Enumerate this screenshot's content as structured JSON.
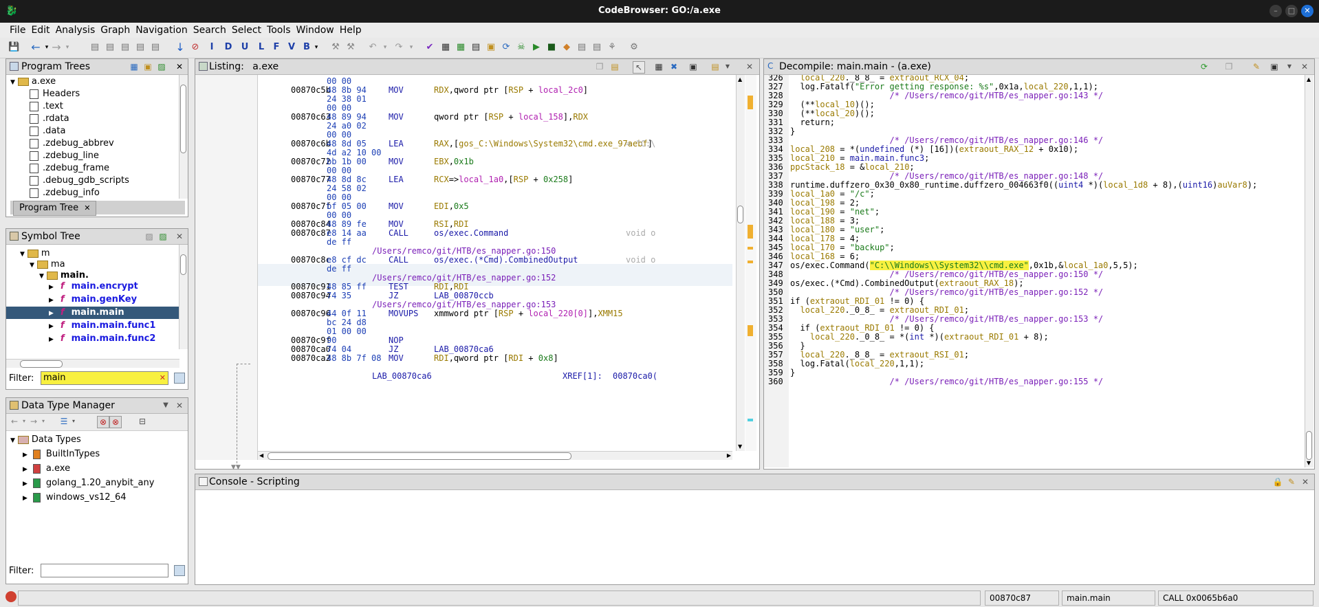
{
  "window": {
    "title": "CodeBrowser: GO:/a.exe"
  },
  "menu": [
    "File",
    "Edit",
    "Analysis",
    "Graph",
    "Navigation",
    "Search",
    "Select",
    "Tools",
    "Window",
    "Help"
  ],
  "program_trees": {
    "title": "Program Trees",
    "root": "a.exe",
    "items": [
      "Headers",
      ".text",
      ".rdata",
      ".data",
      ".zdebug_abbrev",
      ".zdebug_line",
      ".zdebug_frame",
      ".debug_gdb_scripts",
      ".zdebug_info"
    ],
    "tab_label": "Program Tree"
  },
  "symbol_tree": {
    "title": "Symbol Tree",
    "folders": [
      "m",
      "ma",
      "main."
    ],
    "functions": [
      "main.encrypt",
      "main.genKey",
      "main.main",
      "main.main.func1",
      "main.main.func2"
    ],
    "filter_label": "Filter:",
    "filter_value": "main"
  },
  "data_type_manager": {
    "title": "Data Type Manager",
    "root": "Data Types",
    "items": [
      "BuiltInTypes",
      "a.exe",
      "golang_1.20_anybit_any",
      "windows_vs12_64"
    ],
    "filter_label": "Filter:"
  },
  "listing": {
    "title": "Listing:",
    "program": "a.exe",
    "rows": [
      {
        "addr": "",
        "bytes": "00 00",
        "mnem": "",
        "ops": ""
      },
      {
        "addr": "00870c5b",
        "bytes": "48 8b 94",
        "mnem": "MOV",
        "ops": "RDX,qword ptr [RSP + local_2c0]"
      },
      {
        "addr": "",
        "bytes": "24 38 01",
        "mnem": "",
        "ops": ""
      },
      {
        "addr": "",
        "bytes": "00 00",
        "mnem": "",
        "ops": ""
      },
      {
        "addr": "00870c63",
        "bytes": "48 89 94",
        "mnem": "MOV",
        "ops": "qword ptr [RSP + local_158],RDX"
      },
      {
        "addr": "",
        "bytes": "24 a0 02",
        "mnem": "",
        "ops": ""
      },
      {
        "addr": "",
        "bytes": "00 00",
        "mnem": "",
        "ops": ""
      },
      {
        "addr": "00870c6b",
        "bytes": "48 8d 05",
        "mnem": "LEA",
        "ops": "RAX,[gos_C:\\Windows\\System32\\cmd.exe_97aebf]",
        "right": "= \"C:\\"
      },
      {
        "addr": "",
        "bytes": "4d a2 10 00",
        "mnem": "",
        "ops": ""
      },
      {
        "addr": "00870c72",
        "bytes": "bb 1b 00",
        "mnem": "MOV",
        "ops": "EBX,0x1b"
      },
      {
        "addr": "",
        "bytes": "00 00",
        "mnem": "",
        "ops": ""
      },
      {
        "addr": "00870c77",
        "bytes": "48 8d 8c",
        "mnem": "LEA",
        "ops": "RCX=>local_1a0,[RSP + 0x258]"
      },
      {
        "addr": "",
        "bytes": "24 58 02",
        "mnem": "",
        "ops": ""
      },
      {
        "addr": "",
        "bytes": "00 00",
        "mnem": "",
        "ops": ""
      },
      {
        "addr": "00870c7f",
        "bytes": "bf 05 00",
        "mnem": "MOV",
        "ops": "EDI,0x5"
      },
      {
        "addr": "",
        "bytes": "00 00",
        "mnem": "",
        "ops": ""
      },
      {
        "addr": "00870c84",
        "bytes": "48 89 fe",
        "mnem": "MOV",
        "ops": "RSI,RDI"
      },
      {
        "addr": "00870c87",
        "bytes": "e8 14 aa",
        "mnem": "CALL",
        "ops": "os/exec.Command",
        "right": "void o"
      },
      {
        "addr": "",
        "bytes": "de ff",
        "mnem": "",
        "ops": ""
      },
      {
        "addr": "",
        "bytes": "",
        "mnem": "",
        "ops": "",
        "path": "/Users/remco/git/HTB/es_napper.go:150"
      },
      {
        "addr": "00870c8c",
        "bytes": "e8 cf dc",
        "mnem": "CALL",
        "ops": "os/exec.(*Cmd).CombinedOutput",
        "right": "void o"
      },
      {
        "addr": "",
        "bytes": "de ff",
        "mnem": "",
        "ops": ""
      },
      {
        "addr": "",
        "bytes": "",
        "mnem": "",
        "ops": "",
        "path": "/Users/remco/git/HTB/es_napper.go:152"
      },
      {
        "addr": "00870c91",
        "bytes": "48 85 ff",
        "mnem": "TEST",
        "ops": "RDI,RDI"
      },
      {
        "addr": "00870c94",
        "bytes": "74 35",
        "mnem": "JZ",
        "ops": "LAB_00870ccb"
      },
      {
        "addr": "",
        "bytes": "",
        "mnem": "",
        "ops": "",
        "path": "/Users/remco/git/HTB/es_napper.go:153"
      },
      {
        "addr": "00870c96",
        "bytes": "44 0f 11",
        "mnem": "MOVUPS",
        "ops": "xmmword ptr [RSP + local_220[0]],XMM15"
      },
      {
        "addr": "",
        "bytes": "bc 24 d8",
        "mnem": "",
        "ops": ""
      },
      {
        "addr": "",
        "bytes": "01 00 00",
        "mnem": "",
        "ops": ""
      },
      {
        "addr": "00870c9f",
        "bytes": "90",
        "mnem": "NOP",
        "ops": ""
      },
      {
        "addr": "00870ca0",
        "bytes": "74 04",
        "mnem": "JZ",
        "ops": "LAB_00870ca6"
      },
      {
        "addr": "00870ca2",
        "bytes": "48 8b 7f 08",
        "mnem": "MOV",
        "ops": "RDI,qword ptr [RDI + 0x8]"
      },
      {
        "addr": "",
        "bytes": "",
        "mnem": "",
        "ops": ""
      },
      {
        "addr": "",
        "bytes": "",
        "mnem": "",
        "ops": "",
        "label": "LAB_00870ca6",
        "xref": "XREF[1]:",
        "xref_to": "00870ca0("
      }
    ]
  },
  "decompile": {
    "title": "Decompile: main.main -  (a.exe)",
    "lines": [
      {
        "n": "326",
        "t": "  local_220._8_8_ = extraout_RCX_04;"
      },
      {
        "n": "327",
        "t": "  log.Fatalf(\"Error getting response: %s\",0x1a,local_220,1,1);"
      },
      {
        "n": "328",
        "t": "                    /* /Users/remco/git/HTB/es_napper.go:143 */"
      },
      {
        "n": "329",
        "t": "  (**local_10)();"
      },
      {
        "n": "330",
        "t": "  (**local_20)();"
      },
      {
        "n": "331",
        "t": "  return;"
      },
      {
        "n": "332",
        "t": "}"
      },
      {
        "n": "333",
        "t": "                    /* /Users/remco/git/HTB/es_napper.go:146 */"
      },
      {
        "n": "334",
        "t": "local_208 = *(undefined (*) [16])(extraout_RAX_12 + 0x10);"
      },
      {
        "n": "335",
        "t": "local_210 = main.main.func3;"
      },
      {
        "n": "336",
        "t": "ppcStack_18 = &local_210;"
      },
      {
        "n": "337",
        "t": "                    /* /Users/remco/git/HTB/es_napper.go:148 */"
      },
      {
        "n": "338",
        "t": "runtime.duffzero_0x30_0x80_runtime.duffzero_004663f0((uint4 *)(local_1d8 + 8),(uint16)auVar8);"
      },
      {
        "n": "339",
        "t": "local_1a0 = \"/c\";"
      },
      {
        "n": "340",
        "t": "local_198 = 2;"
      },
      {
        "n": "341",
        "t": "local_190 = \"net\";"
      },
      {
        "n": "342",
        "t": "local_188 = 3;"
      },
      {
        "n": "343",
        "t": "local_180 = \"user\";"
      },
      {
        "n": "344",
        "t": "local_178 = 4;"
      },
      {
        "n": "345",
        "t": "local_170 = \"backup\";"
      },
      {
        "n": "346",
        "t": "local_168 = 6;"
      },
      {
        "n": "347",
        "t": "os/exec.Command(\"C:\\\\Windows\\\\System32\\\\cmd.exe\",0x1b,&local_1a0,5,5);"
      },
      {
        "n": "348",
        "t": "                    /* /Users/remco/git/HTB/es_napper.go:150 */"
      },
      {
        "n": "349",
        "t": "os/exec.(*Cmd).CombinedOutput(extraout_RAX_18);"
      },
      {
        "n": "350",
        "t": "                    /* /Users/remco/git/HTB/es_napper.go:152 */"
      },
      {
        "n": "351",
        "t": "if (extraout_RDI_01 != 0) {"
      },
      {
        "n": "352",
        "t": "  local_220._0_8_ = extraout_RDI_01;"
      },
      {
        "n": "353",
        "t": "                    /* /Users/remco/git/HTB/es_napper.go:153 */"
      },
      {
        "n": "354",
        "t": "  if (extraout_RDI_01 != 0) {"
      },
      {
        "n": "355",
        "t": "    local_220._0_8_ = *(int *)(extraout_RDI_01 + 8);"
      },
      {
        "n": "356",
        "t": "  }"
      },
      {
        "n": "357",
        "t": "  local_220._8_8_ = extraout_RSI_01;"
      },
      {
        "n": "358",
        "t": "  log.Fatal(local_220,1,1);"
      },
      {
        "n": "359",
        "t": "}"
      },
      {
        "n": "360",
        "t": "                    /* /Users/remco/git/HTB/es_napper.go:155 */"
      }
    ]
  },
  "console": {
    "title": "Console - Scripting"
  },
  "status": {
    "address": "00870c87",
    "function": "main.main",
    "instruction": "CALL 0x0065b6a0"
  }
}
